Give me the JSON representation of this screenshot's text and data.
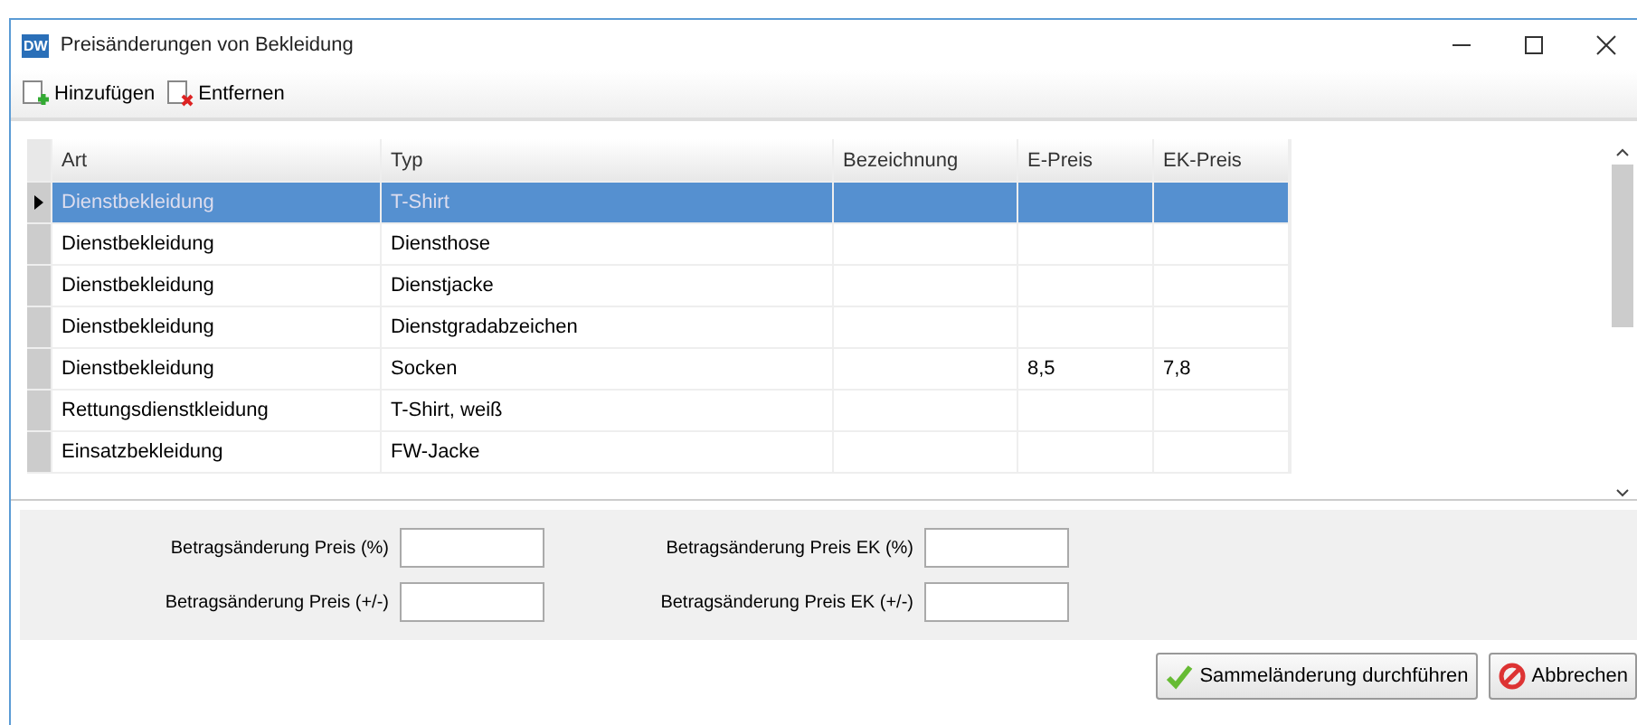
{
  "window": {
    "title": "Preisänderungen von Bekleidung",
    "logo": "DW"
  },
  "toolbar": [
    {
      "kind": "add",
      "label": "Hinzufügen"
    },
    {
      "kind": "remove",
      "label": "Entfernen"
    }
  ],
  "table": {
    "columns": [
      "Art",
      "Typ",
      "Bezeichnung",
      "E-Preis",
      "EK-Preis"
    ],
    "rows": [
      {
        "cells": [
          "Dienstbekleidung",
          "T-Shirt",
          "",
          "",
          ""
        ],
        "selected": true
      },
      {
        "cells": [
          "Dienstbekleidung",
          "Diensthose",
          "",
          "",
          ""
        ],
        "selected": false
      },
      {
        "cells": [
          "Dienstbekleidung",
          "Dienstjacke",
          "",
          "",
          ""
        ],
        "selected": false
      },
      {
        "cells": [
          "Dienstbekleidung",
          "Dienstgradabzeichen",
          "",
          "",
          ""
        ],
        "selected": false
      },
      {
        "cells": [
          "Dienstbekleidung",
          "Socken",
          "",
          "8,5",
          "7,8"
        ],
        "selected": false
      },
      {
        "cells": [
          "Rettungsdienstkleidung",
          "T-Shirt, weiß",
          "",
          "",
          ""
        ],
        "selected": false
      },
      {
        "cells": [
          "Einsatzbekleidung",
          "FW-Jacke",
          "",
          "",
          ""
        ],
        "selected": false
      }
    ]
  },
  "fields": [
    {
      "label": "Betragsänderung Preis (%)"
    },
    {
      "label": "Betragsänderung Preis EK (%)"
    },
    {
      "label": "Betragsänderung Preis (+/-)"
    },
    {
      "label": "Betragsänderung Preis EK (+/-)"
    }
  ],
  "buttons": [
    {
      "kind": "ok",
      "label": "Sammeländerung durchführen"
    },
    {
      "kind": "cancel",
      "label": "Abbrechen"
    }
  ]
}
